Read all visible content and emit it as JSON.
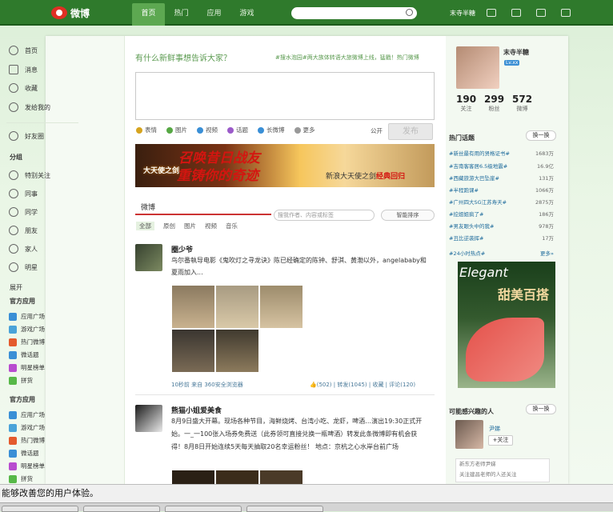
{
  "topbar": {
    "logo_text": "微博",
    "nav": [
      "首页",
      "热门",
      "应用",
      "游戏"
    ],
    "search_placeholder": "",
    "user": "末寺半糖",
    "icons": [
      "edit-icon",
      "message-icon",
      "settings-icon",
      "power-icon"
    ]
  },
  "left": {
    "main_items": [
      "首页",
      "消息",
      "收藏",
      "发给我的"
    ],
    "friends": "好友圈",
    "group_head": "分组",
    "groups": [
      "特别关注",
      "同事",
      "同学",
      "朋友",
      "家人",
      "明星"
    ],
    "expand": "展开",
    "apps_head1": "官方应用",
    "apps1": [
      "应用广场",
      "游戏广场",
      "热门微博",
      "微话题",
      "明星榜单",
      "拼货"
    ],
    "apps_head2": "官方应用",
    "apps2": [
      "应用广场",
      "游戏广场",
      "热门微博",
      "微话题",
      "明星榜单",
      "拼货"
    ]
  },
  "composer": {
    "prompt": "有什么新鲜事想告诉大家？",
    "hint": "#搜水泡园#两大族体转语大旅微博上线，猛戳！热门微博",
    "tools": [
      "表情",
      "图片",
      "视频",
      "话题",
      "长微博",
      "更多"
    ],
    "public": "公开",
    "send": "发布"
  },
  "banner": {
    "brand": "大天使之剑",
    "line1": "召唤昔日战友",
    "line2": "重铸你的奇迹",
    "tag_prefix": "新浪大天使之剑",
    "tag_highlight": "经典回归"
  },
  "feed": {
    "tab": "微博",
    "filter_placeholder": "搜我作者、内容或标签",
    "smart": "智能排序",
    "subtabs": [
      "全部",
      "原创",
      "图片",
      "视频",
      "音乐"
    ],
    "post1": {
      "name": "圈少爷",
      "text": "鸟尔番執导电影《鬼吹灯之寻龙诀》陈已经确定的陈钟、舒淇、黄渤以外，angelababy和夏雨加入...",
      "meta": "10秒前  来自  360安全浏览器",
      "likes": "(502)",
      "repost": "转发(1045)",
      "fav": "收藏",
      "comment": "评论(120)"
    },
    "post2": {
      "name": "熊猫小姐爱美食",
      "text": "8月9日盛大开幕。现场各种节目，海鲜烧烤、台湾小吃、龙虾，啤酒…演出19:30正式开始。一_一100张入场券免费送（此券领可直接兑换一瓶啤酒）转发此条微博即有机会获得！8月8日开始连续5天每天抽取20名幸运粉丝！ 地点：京杭之心水岸台前广场"
    }
  },
  "right": {
    "name": "末寺半糖",
    "badge": "Lv.xx",
    "stats": [
      {
        "num": "190",
        "label": "关注"
      },
      {
        "num": "299",
        "label": "粉丝"
      },
      {
        "num": "572",
        "label": "微博"
      }
    ],
    "hot_head": "热门话题",
    "refresh": "换一换",
    "topics": [
      {
        "t": "#新丝最有用的贤格证书#",
        "n": "1683万"
      },
      {
        "t": "#吉南客客居6.5级地震#",
        "n": "16.9亿"
      },
      {
        "t": "#西藏旅游大巴坠崖#",
        "n": "131万"
      },
      {
        "t": "#半程跑课#",
        "n": "1066万"
      },
      {
        "t": "#广州四大SG江苏寿天#",
        "n": "2875万"
      },
      {
        "t": "#挖姐姐疯了#",
        "n": "186万"
      },
      {
        "t": "#男友眼头中的我#",
        "n": "978万"
      },
      {
        "t": "#丑比逆袭挥#",
        "n": "17万"
      }
    ],
    "hot24": "#24小时热点#",
    "more": "更多»",
    "ad_t1": "Elegant",
    "ad_t2": "甜美百搭",
    "maybe_head": "可能感兴趣的人",
    "maybe_refresh": "换一换",
    "sugg_name": "尹娣",
    "sugg_follow": "+关注",
    "sugg_box1": "新东方老师尹娣",
    "sugg_box2": "关注建昌老师的人还关注"
  },
  "status_bar": "能够改善您的用户体验。"
}
